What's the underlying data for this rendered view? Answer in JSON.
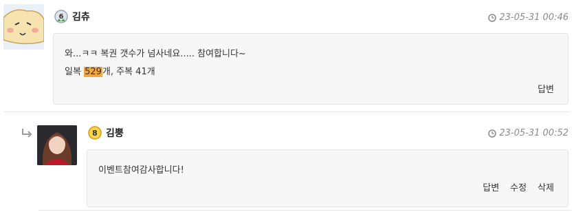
{
  "comments": [
    {
      "author": "김츄",
      "level": "6",
      "timestamp": "23-05-31 00:46",
      "body_line1": "와...ㅋㅋ 복권 갯수가 넘사네요..... 참여합니다~",
      "body_line2_pre": "일복 ",
      "body_line2_highlight": "529",
      "body_line2_post": "개, 주복 41개",
      "actions": {
        "reply": "답변"
      }
    },
    {
      "author": "김뿡",
      "level": "8",
      "timestamp": "23-05-31 00:52",
      "body_line1": "이벤트참여감사합니다!",
      "actions": {
        "reply": "답변",
        "edit": "수정",
        "delete": "삭제"
      }
    }
  ],
  "colors": {
    "highlight": "#f4a640",
    "level6_badge": "#9aa8b5",
    "level8_badge": "#f1b51c"
  },
  "icons": [
    "reply-arrow-icon",
    "level-badge-icon",
    "clock-icon"
  ]
}
